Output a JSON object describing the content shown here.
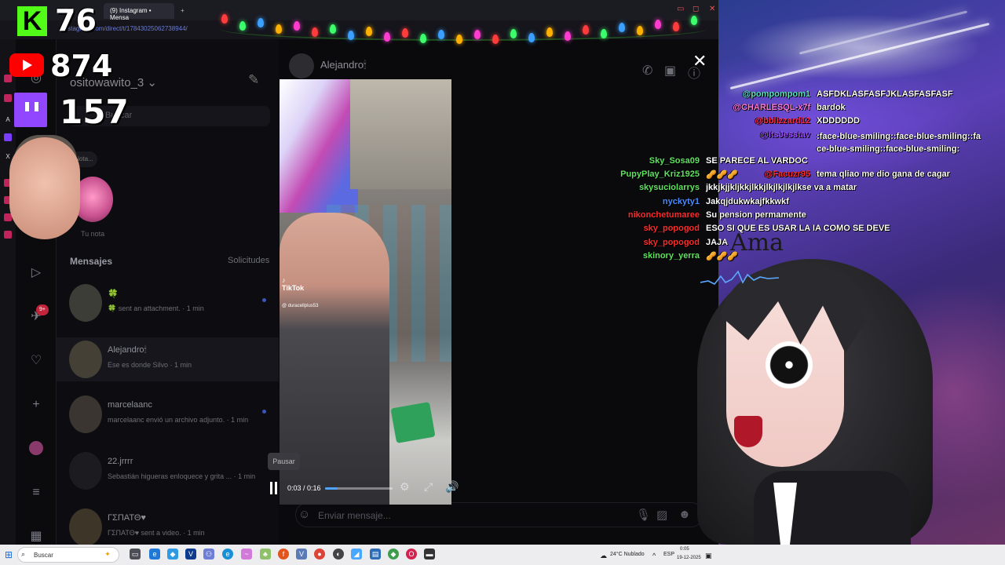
{
  "counters": {
    "kick": "76",
    "youtube": "874",
    "twitch": "157"
  },
  "browser": {
    "tabs": [
      {
        "label": "(9) Instagram • Mensa"
      },
      {
        "label": "+"
      }
    ],
    "url": "instagram.com/direct/t/17843025062738944/"
  },
  "instagram": {
    "username": "ositowawito_3",
    "search_placeholder": "Buscar",
    "note_bubble": "Nota...",
    "your_note": "Tu nota",
    "messages_header": "Mensajes",
    "requests_label": "Solicitudes",
    "conversations": [
      {
        "name": "🍀",
        "subtitle": "🍀 sent an attachment. · 1 min"
      },
      {
        "name": "Alejandro🕯",
        "subtitle": "Ese es donde Silvo · 1 min"
      },
      {
        "name": "marcelaanc",
        "subtitle": "marcelaanc envió un archivo adjunto. · 1 min"
      },
      {
        "name": "22.jrrrr",
        "subtitle": "Sebastián higueras enloquece y grita ... · 1 min"
      },
      {
        "name": "ΓΣΠΑΤΘ♥",
        "subtitle": "ΓΣΠΑΤΘ♥ sent a video. · 1 min"
      }
    ],
    "chat_header_name": "Alejandro🕯",
    "message_placeholder": "Enviar mensaje...",
    "rail_badge": "9+"
  },
  "video": {
    "tiktok_label": "TikTok",
    "tiktok_user": "@ duracellplus53",
    "tooltip": "Pausar",
    "time": "0:03 / 0:16",
    "progress": 0.19
  },
  "stream_chat": [
    {
      "user": "@pompompom1",
      "msg": "ASFDKLASFASFJKLASFASFASF",
      "color": "#5fe3c8"
    },
    {
      "user": "@CHARLESQL-x7f",
      "msg": "bardok",
      "color": "#ff7ad9"
    },
    {
      "user": "@bblizzard12",
      "msg": "XDDDDDD",
      "color": "#ff2a4a"
    },
    {
      "user": "@ItsJesstav",
      "msg": ":face-blue-smiling::face-blue-smiling::face-blue-smiling::face-blue-smiling:",
      "color": "#9a4dff"
    },
    {
      "user": "Sky_Sosa09",
      "msg": "SE PARECE AL VARDOC",
      "color": "#5fe35f"
    },
    {
      "user": "@Facuzr95",
      "msg": "tema qliao me dio gana de cagar",
      "color": "#ff2a2a"
    },
    {
      "user": "PupyPlay_Kriz1925",
      "msg": "🥜🥜🥜",
      "color": "#5fe35f"
    },
    {
      "user": "skysuciolarrys",
      "msg": "jkkjkjjkljkkjlkkjlkjlkjlkjlkse va a matar",
      "color": "#5fe35f"
    },
    {
      "user": "nyckyty1",
      "msg": "Jakqjdukwkajfkkwkf",
      "color": "#4a8cff"
    },
    {
      "user": "nikonchetumaree",
      "msg": "Su pension permamente",
      "color": "#ff2a2a"
    },
    {
      "user": "sky_popogod",
      "msg": "ESO SI QUE ES USAR LA IA COMO SE DEVE",
      "color": "#ff2a2a"
    },
    {
      "user": "sky_popogod",
      "msg": "JAJA",
      "color": "#ff2a2a"
    },
    {
      "user": "skinory_yerra",
      "msg": "🥜🥜🥜",
      "color": "#5fe35f"
    }
  ],
  "overlay_text": "Ama",
  "taskbar": {
    "search": "Buscar",
    "weather": "24°C Nublado",
    "lang": "ESP",
    "time": "0:05",
    "date": "19-12-2025"
  }
}
